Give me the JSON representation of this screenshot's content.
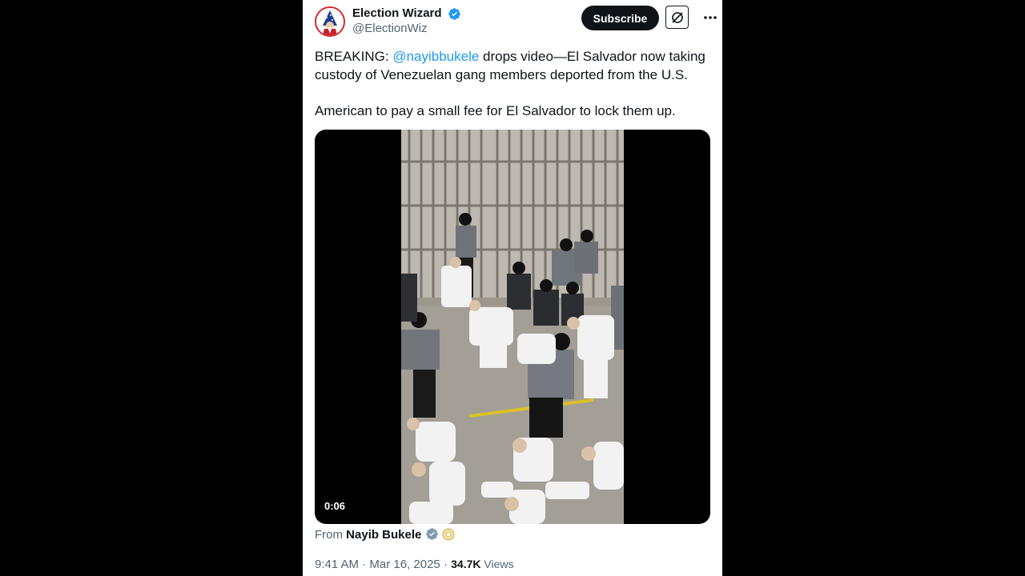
{
  "author": {
    "display_name": "Election Wizard",
    "handle": "@ElectionWiz"
  },
  "header": {
    "subscribe_label": "Subscribe"
  },
  "tweet": {
    "prefix": "BREAKING: ",
    "mention": "@nayibbukele",
    "line1_rest": " drops video—El Salvador now taking custody of Venezuelan gang members deported from the U.S.",
    "paragraph2": "American to pay a small fee for El Salvador to lock them up."
  },
  "media": {
    "duration": "0:06"
  },
  "source": {
    "prefix": "From ",
    "name": "Nayib Bukele"
  },
  "meta": {
    "time": "9:41 AM",
    "separator": " · ",
    "date": "Mar 16, 2025",
    "views_count": "34.7K",
    "views_label": " Views"
  },
  "colors": {
    "link": "#1d9bf0",
    "verified": "#1d9bf0",
    "background": "#000000",
    "card": "#ffffff"
  },
  "icons": [
    "verified-badge-icon",
    "grok-icon",
    "more-icon",
    "government-badge-icon",
    "avatar-logo-icon"
  ]
}
